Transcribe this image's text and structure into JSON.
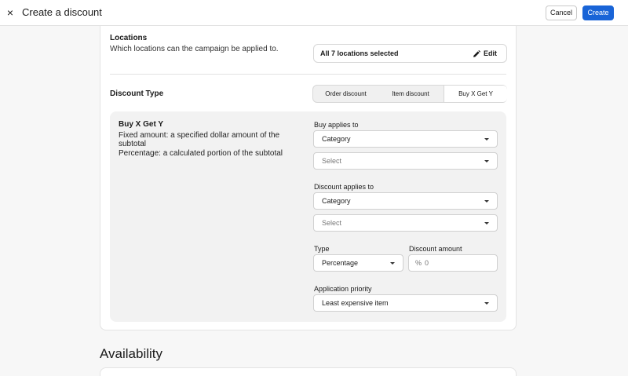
{
  "header": {
    "title": "Create a discount",
    "close_icon": "×",
    "cancel_label": "Cancel",
    "create_label": "Create",
    "accent_color": "#1964d7"
  },
  "locations": {
    "title": "Locations",
    "description": "Which locations can the campaign be applied to.",
    "selected_text": "All 7 locations selected",
    "edit_label": "Edit",
    "edit_icon": "pencil-icon"
  },
  "discount_type": {
    "title": "Discount Type",
    "options": [
      "Order discount",
      "Item discount",
      "Buy X Get Y"
    ],
    "selected": "Buy X Get Y"
  },
  "bxgy": {
    "title": "Buy X Get Y",
    "description_lines": [
      "Fixed amount: a specified dollar amount of the",
      "subtotal",
      "Percentage: a calculated portion of the subtotal"
    ],
    "buy_applies_to": {
      "label": "Buy applies to",
      "primary_value": "Category",
      "secondary_placeholder": "Select"
    },
    "discount_applies_to": {
      "label": "Discount applies to",
      "primary_value": "Category",
      "secondary_placeholder": "Select"
    },
    "type": {
      "label": "Type",
      "value": "Percentage"
    },
    "discount_amount": {
      "label": "Discount amount",
      "prefix": "%",
      "value": "0"
    },
    "application_priority": {
      "label": "Application priority",
      "value": "Least expensive item"
    }
  },
  "availability": {
    "title": "Availability"
  }
}
